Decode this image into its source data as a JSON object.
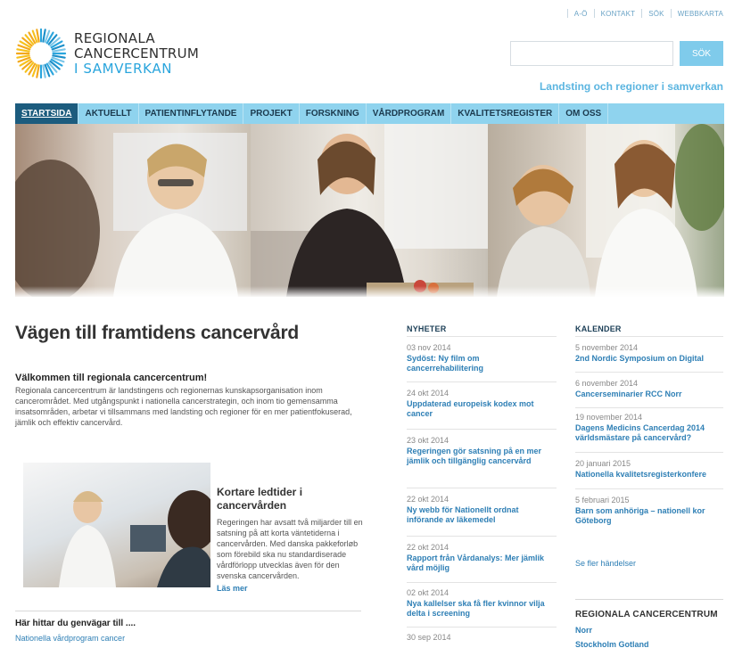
{
  "utility_nav": [
    "A-Ö",
    "KONTAKT",
    "SÖK",
    "WEBBKARTA"
  ],
  "logo": {
    "line1": "REGIONALA",
    "line2": "CANCERCENTRUM",
    "line3": "I SAMVERKAN"
  },
  "search": {
    "value": "",
    "button_label": "SÖK"
  },
  "tagline": "Landsting och regioner i samverkan",
  "main_nav": [
    "STARTSIDA",
    "AKTUELLT",
    "PATIENTINFLYTANDE",
    "PROJEKT",
    "FORSKNING",
    "VÅRDPROGRAM",
    "KVALITETSREGISTER",
    "OM OSS"
  ],
  "main": {
    "heading": "Vägen till framtidens cancervård",
    "welcome_heading": "Välkommen till regionala cancercentrum!",
    "welcome_text": "Regionala cancercentrum är landstingens och regionernas kunskapsorganisation inom cancerområdet. Med utgångspunkt i nationella cancerstrategin, och inom tio gemensamma insatsområden, arbetar vi tillsammans med landsting och regioner för en mer patientfokuserad, jämlik och effektiv cancervård.",
    "feature_heading": "Kortare ledtider i cancervården",
    "feature_text": "Regeringen har avsatt två miljarder till en satsning på att korta väntetiderna i cancervården. Med danska pakkeforløb som förebild ska nu standardiserade vårdförlopp utvecklas även för den svenska cancervården.",
    "feature_more": "Läs mer",
    "shortcuts_heading": "Här hittar du genvägar till ....",
    "shortcuts_first": "Nationella vårdprogram cancer"
  },
  "news": {
    "heading": "NYHETER",
    "items": [
      {
        "date": "03 nov 2014",
        "title": "Sydöst: Ny film om cancerrehabilitering"
      },
      {
        "date": "24 okt 2014",
        "title": "Uppdaterad europeisk kodex mot cancer"
      },
      {
        "date": "23 okt 2014",
        "title": "Regeringen gör satsning på en mer jämlik och tillgänglig cancervård"
      },
      {
        "date": "22 okt 2014",
        "title": "Ny webb för Nationellt ordnat införande av läkemedel"
      },
      {
        "date": "22 okt 2014",
        "title": "Rapport från Vårdanalys: Mer jämlik vård möjlig"
      },
      {
        "date": "02 okt 2014",
        "title": "Nya kallelser ska få fler kvinnor vilja delta i screening"
      },
      {
        "date": "30 sep 2014",
        "title": ""
      }
    ]
  },
  "calendar": {
    "heading": "KALENDER",
    "items": [
      {
        "date": "5 november 2014",
        "title": "2nd Nordic Symposium on Digital"
      },
      {
        "date": "6 november 2014",
        "title": "Cancerseminarier RCC Norr"
      },
      {
        "date": "19 november 2014",
        "title": "Dagens Medicins Cancerdag 2014 världsmästare på cancervård?"
      },
      {
        "date": "20 januari 2015",
        "title": "Nationella kvalitetsregisterkonfere"
      },
      {
        "date": "5 februari 2015",
        "title": "Barn som anhöriga – nationell kor Göteborg"
      }
    ],
    "more": "Se fler händelser"
  },
  "rcc": {
    "heading": "REGIONALA CANCERCENTRUM",
    "items": [
      "Norr",
      "Stockholm Gotland"
    ]
  },
  "colors": {
    "nav_bg": "#8fd3ee",
    "nav_active": "#1c5c7e",
    "link": "#2e7fb5",
    "accent": "#2aa5dd"
  }
}
